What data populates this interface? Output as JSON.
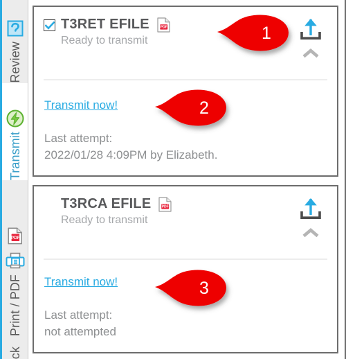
{
  "rail": {
    "accent_color": "#29abe2",
    "tabs": [
      {
        "label": "Review",
        "icon": "help-question-icon",
        "active": false
      },
      {
        "label": "Transmit",
        "icon": "lightning-bolt-icon",
        "active": true
      },
      {
        "label": "Print / PDF",
        "icon": "printer-icon",
        "active": false
      },
      {
        "label": "ck",
        "icon": "none",
        "active": false
      }
    ]
  },
  "cards": [
    {
      "title": "T3RET EFILE",
      "has_checkbox": true,
      "checked": true,
      "pdf_icon": "pdf-file-icon",
      "status": "Ready to transmit",
      "upload_icon": "upload-arrow-icon",
      "collapse_icon": "chevron-up-icon",
      "link": "Transmit now!",
      "attempt_label": "Last attempt:",
      "attempt_value": "2022/01/28 4:09PM by Elizabeth."
    },
    {
      "title": "T3RCA EFILE",
      "has_checkbox": false,
      "checked": false,
      "pdf_icon": "pdf-file-icon",
      "status": "Ready to transmit",
      "upload_icon": "upload-arrow-icon",
      "collapse_icon": "chevron-up-icon",
      "link": "Transmit now!",
      "attempt_label": "Last attempt:",
      "attempt_value": "not attempted"
    }
  ],
  "callouts": [
    {
      "number": "1"
    },
    {
      "number": "2"
    },
    {
      "number": "3"
    }
  ],
  "colors": {
    "accent_blue": "#29abe2",
    "callout_red": "#ee0000",
    "title_gray": "#58595b",
    "muted_gray": "#a6a8ab",
    "card_border": "#6d6d6d"
  }
}
